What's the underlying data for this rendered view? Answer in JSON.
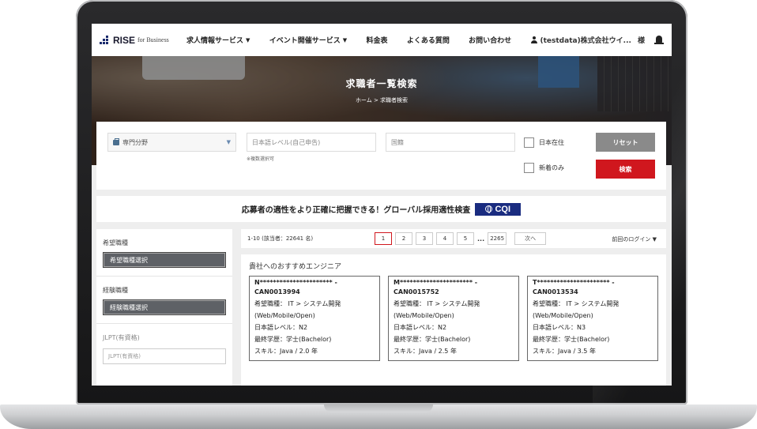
{
  "header": {
    "logo_main": "RISE",
    "logo_sub": "for Business",
    "nav": [
      "求人情報サービス",
      "イベント開催サービス",
      "料金表",
      "よくある質問",
      "お問い合わせ"
    ],
    "user": "(testdata)株式会社ウイ...",
    "user_suffix": "様"
  },
  "hero": {
    "title": "求職者一覧検索",
    "breadcrumb": "ホーム > 求職者検索"
  },
  "search": {
    "specialty_label": "専門分野",
    "jlpt_placeholder": "日本語レベル(自己申告)",
    "multi_note": "※複数選択可",
    "nationality_placeholder": "国籍",
    "residing_japan": "日本在住",
    "new_only": "新着のみ",
    "reset": "リセット",
    "search": "検索"
  },
  "banner": {
    "text": "応募者の適性をより正確に把握できる！グローバル採用適性検査",
    "badge": "CQI"
  },
  "sidebar": {
    "desired_label": "希望職種",
    "desired_button": "希望職種選択",
    "experience_label": "経験職種",
    "experience_button": "経験職種選択",
    "jlpt_label": "JLPT(有資格)",
    "jlpt_input": "JLPT(有資格)"
  },
  "results": {
    "count_text": "1-10 (該当者：22641 名)",
    "pages": [
      "1",
      "2",
      "3",
      "4",
      "5"
    ],
    "ellipsis": "...",
    "last_page": "2265",
    "next": "次へ",
    "sort": "前回のログイン",
    "reco_title": "貴社へのおすすめエンジニア",
    "cards": [
      {
        "name": "N********************** -",
        "id": "CAN0013994",
        "desired": "希望職種： IT > システム開発",
        "desired2": "(Web/Mobile/Open)",
        "jlpt": "日本語レベル：N2",
        "edu": "最終学歴：学士(Bachelor)",
        "skill": "スキル：Java / 2.0 年"
      },
      {
        "name": "M********************** -",
        "id": "CAN0015752",
        "desired": "希望職種： IT > システム開発",
        "desired2": "(Web/Mobile/Open)",
        "jlpt": "日本語レベル：N2",
        "edu": "最終学歴：学士(Bachelor)",
        "skill": "スキル：Java / 2.5 年"
      },
      {
        "name": "T********************** -",
        "id": "CAN0013534",
        "desired": "希望職種： IT > システム開発",
        "desired2": "(Web/Mobile/Open)",
        "jlpt": "日本語レベル：N3",
        "edu": "最終学歴：学士(Bachelor)",
        "skill": "スキル：Java / 3.5 年"
      }
    ]
  },
  "colors": {
    "accent_red": "#d0171e",
    "brand_navy": "#1a2c80",
    "button_gray": "#8a8a8a"
  }
}
